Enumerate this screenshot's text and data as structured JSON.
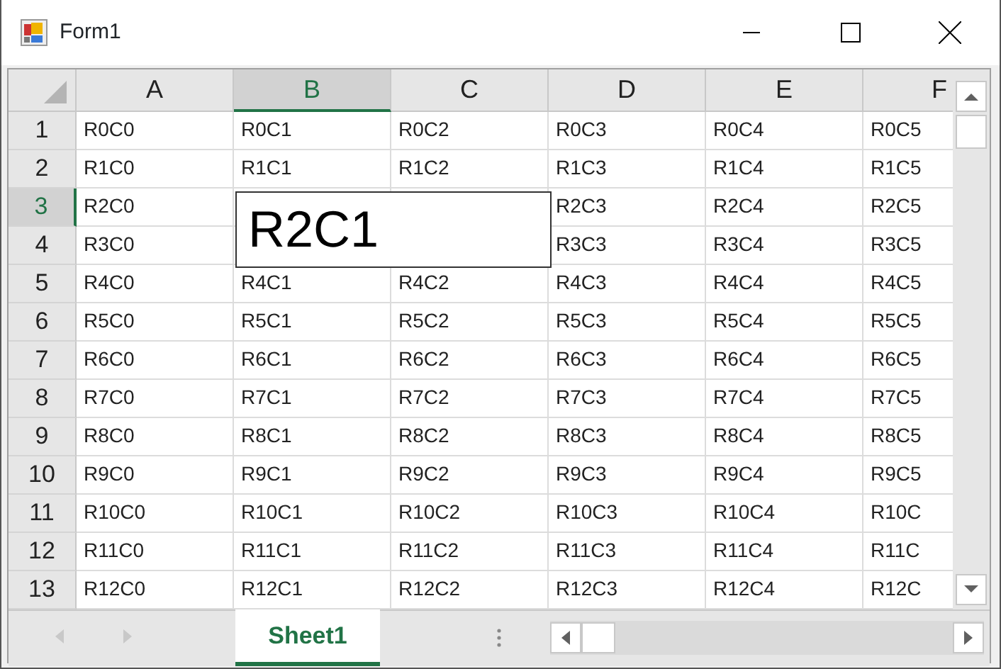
{
  "window": {
    "title": "Form1"
  },
  "columns": [
    {
      "label": "A",
      "selected": false
    },
    {
      "label": "B",
      "selected": true
    },
    {
      "label": "C",
      "selected": false
    },
    {
      "label": "D",
      "selected": false
    },
    {
      "label": "E",
      "selected": false
    },
    {
      "label": "F",
      "selected": false
    }
  ],
  "rows": [
    {
      "label": "1",
      "selected": false,
      "cells": [
        "R0C0",
        "R0C1",
        "R0C2",
        "R0C3",
        "R0C4",
        "R0C5"
      ]
    },
    {
      "label": "2",
      "selected": false,
      "cells": [
        "R1C0",
        "R1C1",
        "R1C2",
        "R1C3",
        "R1C4",
        "R1C5"
      ]
    },
    {
      "label": "3",
      "selected": true,
      "cells": [
        "R2C0",
        null,
        null,
        "R2C3",
        "R2C4",
        "R2C5"
      ]
    },
    {
      "label": "4",
      "selected": false,
      "cells": [
        "R3C0",
        null,
        null,
        "R3C3",
        "R3C4",
        "R3C5"
      ]
    },
    {
      "label": "5",
      "selected": false,
      "cells": [
        "R4C0",
        "R4C1",
        "R4C2",
        "R4C3",
        "R4C4",
        "R4C5"
      ]
    },
    {
      "label": "6",
      "selected": false,
      "cells": [
        "R5C0",
        "R5C1",
        "R5C2",
        "R5C3",
        "R5C4",
        "R5C5"
      ]
    },
    {
      "label": "7",
      "selected": false,
      "cells": [
        "R6C0",
        "R6C1",
        "R6C2",
        "R6C3",
        "R6C4",
        "R6C5"
      ]
    },
    {
      "label": "8",
      "selected": false,
      "cells": [
        "R7C0",
        "R7C1",
        "R7C2",
        "R7C3",
        "R7C4",
        "R7C5"
      ]
    },
    {
      "label": "9",
      "selected": false,
      "cells": [
        "R8C0",
        "R8C1",
        "R8C2",
        "R8C3",
        "R8C4",
        "R8C5"
      ]
    },
    {
      "label": "10",
      "selected": false,
      "cells": [
        "R9C0",
        "R9C1",
        "R9C2",
        "R9C3",
        "R9C4",
        "R9C5"
      ]
    },
    {
      "label": "11",
      "selected": false,
      "cells": [
        "R10C0",
        "R10C1",
        "R10C2",
        "R10C3",
        "R10C4",
        "R10C"
      ]
    },
    {
      "label": "12",
      "selected": false,
      "cells": [
        "R11C0",
        "R11C1",
        "R11C2",
        "R11C3",
        "R11C4",
        "R11C"
      ]
    },
    {
      "label": "13",
      "selected": false,
      "cells": [
        "R12C0",
        "R12C1",
        "R12C2",
        "R12C3",
        "R12C4",
        "R12C"
      ]
    }
  ],
  "editor": {
    "value": "R2C1"
  },
  "sheet_tabs": [
    {
      "label": "Sheet1",
      "selected": true
    }
  ]
}
